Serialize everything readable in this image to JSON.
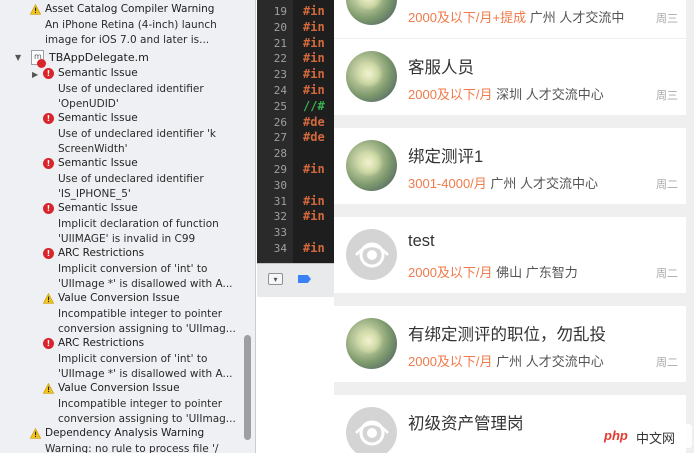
{
  "issues": {
    "top_warning": {
      "title": "Asset Catalog Compiler Warning",
      "desc1": "An iPhone Retina (4-inch) launch",
      "desc2": "image for iOS 7.0 and later is..."
    },
    "file_name": "TBAppDelegate.m",
    "items": [
      {
        "kind": "error",
        "title": "Semantic Issue",
        "desc1": "Use of undeclared identifier",
        "desc2": "'OpenUDID'"
      },
      {
        "kind": "error",
        "title": "Semantic Issue",
        "desc1": "Use of undeclared identifier 'k",
        "desc2": "ScreenWidth'"
      },
      {
        "kind": "error",
        "title": "Semantic Issue",
        "desc1": "Use of undeclared identifier",
        "desc2": "'IS_IPHONE_5'"
      },
      {
        "kind": "error",
        "title": "Semantic Issue",
        "desc1": "Implicit declaration of function",
        "desc2": "'UIIMAGE' is invalid in C99"
      },
      {
        "kind": "error",
        "title": "ARC Restrictions",
        "desc1": "Implicit conversion of 'int' to",
        "desc2": "'UIImage *' is disallowed with A..."
      },
      {
        "kind": "warning",
        "title": "Value Conversion Issue",
        "desc1": "Incompatible integer to pointer",
        "desc2": "conversion assigning to 'UIImag..."
      },
      {
        "kind": "error",
        "title": "ARC Restrictions",
        "desc1": "Implicit conversion of 'int' to",
        "desc2": "'UIImage *' is disallowed with A..."
      },
      {
        "kind": "warning",
        "title": "Value Conversion Issue",
        "desc1": "Incompatible integer to pointer",
        "desc2": "conversion assigning to 'UIImag..."
      }
    ],
    "bottom_warning": {
      "title": "Dependency Analysis Warning",
      "desc1": "Warning: no rule to process file '/"
    }
  },
  "editor": {
    "lines": [
      {
        "num": "19",
        "code": "#in",
        "kind": "directive"
      },
      {
        "num": "20",
        "code": "#in",
        "kind": "directive"
      },
      {
        "num": "21",
        "code": "#in",
        "kind": "directive"
      },
      {
        "num": "22",
        "code": "#in",
        "kind": "directive"
      },
      {
        "num": "23",
        "code": "#in",
        "kind": "directive"
      },
      {
        "num": "24",
        "code": "#in",
        "kind": "directive"
      },
      {
        "num": "25",
        "code": "//#",
        "kind": "comment"
      },
      {
        "num": "26",
        "code": "#de",
        "kind": "directive"
      },
      {
        "num": "27",
        "code": "#de",
        "kind": "directive"
      },
      {
        "num": "28",
        "code": "",
        "kind": "blank"
      },
      {
        "num": "29",
        "code": "#in",
        "kind": "directive"
      },
      {
        "num": "30",
        "code": "",
        "kind": "blank"
      },
      {
        "num": "31",
        "code": "#in",
        "kind": "directive"
      },
      {
        "num": "32",
        "code": "#in",
        "kind": "directive"
      },
      {
        "num": "33",
        "code": "",
        "kind": "blank"
      },
      {
        "num": "34",
        "code": "#in",
        "kind": "directive"
      }
    ]
  },
  "jobs": [
    {
      "title": "",
      "salary": "2000及以下/月+提成",
      "location": "广州 人才交流中",
      "date": "周三",
      "avatar": "flower"
    },
    {
      "title": "客服人员",
      "salary": "2000及以下/月",
      "location": "深圳 人才交流中心",
      "date": "周三",
      "avatar": "flower"
    },
    {
      "title": "绑定测评1",
      "salary": "3001-4000/月",
      "location": "广州 人才交流中心",
      "date": "周二",
      "avatar": "flower"
    },
    {
      "title": "test",
      "salary": "2000及以下/月",
      "location": "佛山 广东智力",
      "date": "周二",
      "avatar": "placeholder"
    },
    {
      "title": "有绑定测评的职位，勿乱投",
      "salary": "2000及以下/月",
      "location": "广州 人才交流中心",
      "date": "周二",
      "avatar": "flower"
    },
    {
      "title": "初级资产管理岗",
      "salary": "",
      "location": "",
      "date": "",
      "avatar": "placeholder"
    }
  ],
  "watermark": {
    "brand": "php",
    "text": "中文网"
  },
  "colors": {
    "error": "#d8252c",
    "warning": "#f2c318",
    "salary": "#f07a4a",
    "code_directive": "#d2693c",
    "code_comment": "#37b24d"
  }
}
